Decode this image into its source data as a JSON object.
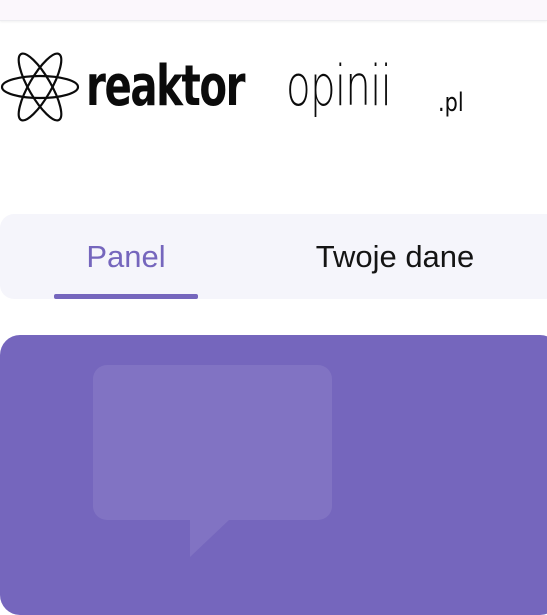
{
  "logo": {
    "icon": "atom-icon",
    "text_bold": "reaktor",
    "text_light": "opinii",
    "text_tld": ".pl"
  },
  "tabs": [
    {
      "label": "Panel",
      "active": true
    },
    {
      "label": "Twoje dane",
      "active": false
    }
  ],
  "hero": {
    "background": "#7566bd",
    "icon": "speech-bubble-icon"
  },
  "colors": {
    "accent": "#7566bd",
    "tab_bar_bg": "#f5f5fb",
    "text": "#141414"
  }
}
